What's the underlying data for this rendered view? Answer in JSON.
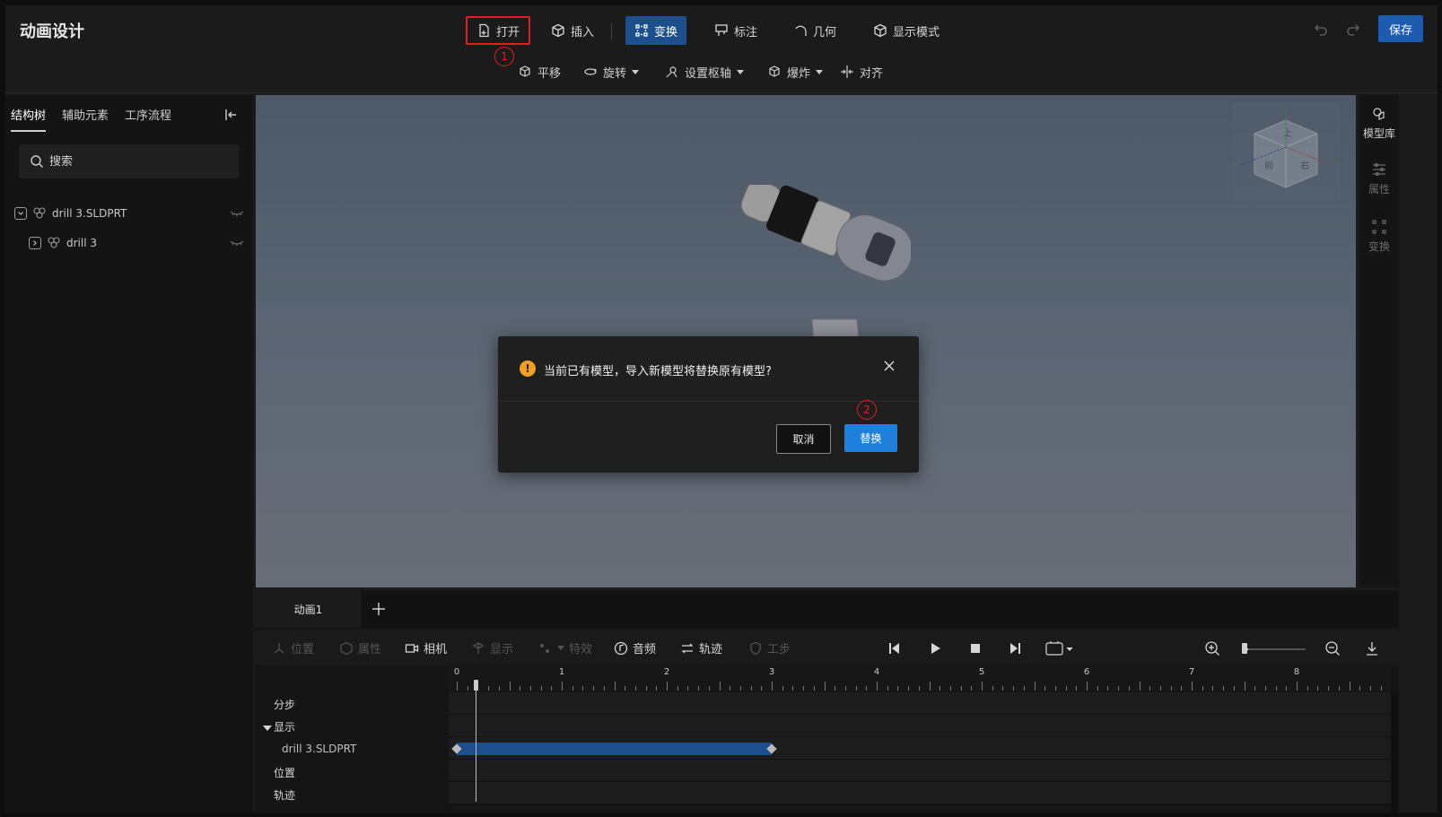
{
  "app": {
    "title": "动画设计"
  },
  "toolbar": {
    "open": "打开",
    "insert": "插入",
    "transform": "变换",
    "annotate": "标注",
    "geometry": "几何",
    "display_mode": "显示模式",
    "save": "保存"
  },
  "toolbar2": {
    "translate": "平移",
    "rotate": "旋转",
    "set_pivot": "设置枢轴",
    "explode": "爆炸",
    "align": "对齐"
  },
  "markers": {
    "first": "1",
    "second": "2"
  },
  "left_panel": {
    "tabs": [
      "结构树",
      "辅助元素",
      "工序流程"
    ],
    "search_placeholder": "搜索",
    "tree": [
      {
        "label": "drill 3.SLDPRT"
      },
      {
        "label": "drill 3"
      }
    ]
  },
  "right_panel": {
    "model_library": "模型库",
    "properties": "属性",
    "transform": "变换"
  },
  "view_cube": {
    "top": "上",
    "front": "前",
    "right": "右"
  },
  "dialog": {
    "icon": "!",
    "message": "当前已有模型，导入新模型将替换原有模型?",
    "cancel": "取消",
    "replace": "替换"
  },
  "timeline": {
    "tab": "动画1",
    "tools": {
      "position": "位置",
      "properties": "属性",
      "camera": "相机",
      "display": "显示",
      "effects": "特效",
      "audio": "音频",
      "trajectory": "轨迹",
      "step": "工步"
    },
    "ruler_labels": [
      "0",
      "1",
      "2",
      "3",
      "4",
      "5",
      "6",
      "7",
      "8"
    ],
    "tracks": [
      "分步",
      "显示",
      "drill 3.SLDPRT",
      "位置",
      "轨迹"
    ],
    "display_bar": {
      "start": 0,
      "end": 3
    }
  },
  "colors": {
    "accent": "#1d4f8c",
    "primary_button": "#1e7fdc",
    "warning": "#f0a020",
    "marker": "#e02020"
  }
}
